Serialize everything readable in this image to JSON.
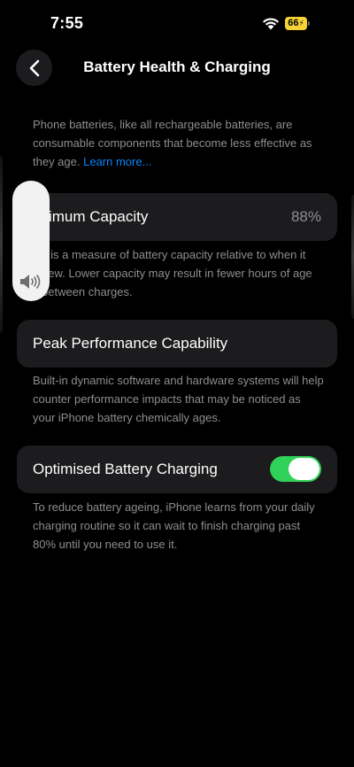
{
  "status_bar": {
    "time": "7:55",
    "battery_level": "66",
    "battery_color": "#f5d337",
    "icons": [
      "wifi-icon",
      "battery-icon",
      "charging-bolt-icon"
    ]
  },
  "nav": {
    "back_icon": "chevron-left-icon",
    "title": "Battery Health & Charging"
  },
  "intro": {
    "text": "Phone batteries, like all rechargeable batteries, are consumable components that become less effective as they age. ",
    "link": "Learn more..."
  },
  "maximum_capacity": {
    "label": "aximum Capacity",
    "value": "88%",
    "description": "s is a measure of battery capacity relative to when it new. Lower capacity may result in fewer hours of age between charges."
  },
  "peak_performance": {
    "label": "Peak Performance Capability",
    "description": "Built-in dynamic software and hardware systems will help counter performance impacts that may be noticed as your iPhone battery chemically ages."
  },
  "optimised_charging": {
    "label": "Optimised Battery Charging",
    "toggle_on": true,
    "toggle_color": "#30d158",
    "description": "To reduce battery ageing, iPhone learns from your daily charging routine so it can wait to finish charging past 80% until you need to use it."
  },
  "volume_hud": {
    "icon": "speaker-volume-icon"
  },
  "colors": {
    "background": "#000000",
    "card": "#1c1c1e",
    "secondary_text": "#8e8e93",
    "link": "#0a84ff"
  }
}
